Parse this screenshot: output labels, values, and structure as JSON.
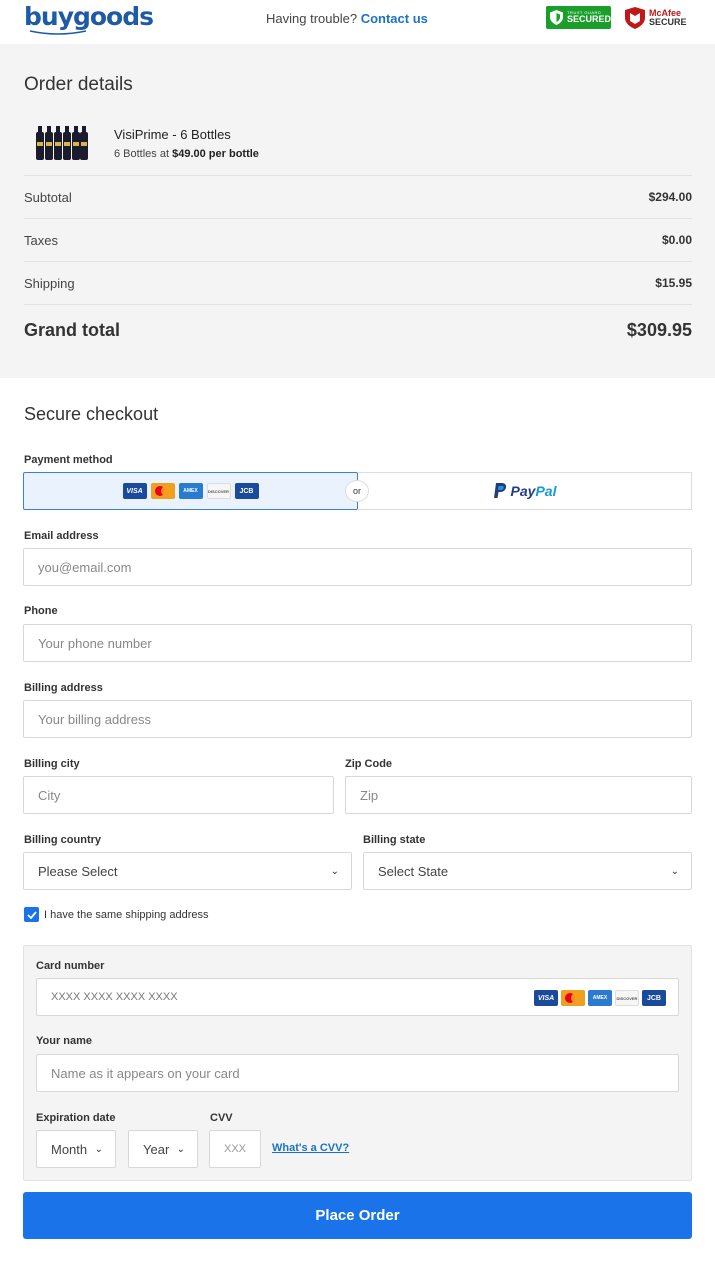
{
  "header": {
    "logo": "buygoods",
    "trouble_text": "Having trouble?",
    "contact_link": "Contact us",
    "trust_badge": "SECURED",
    "trust_badge_small": "TRUST GUARD",
    "mcafee_top": "McAfee",
    "mcafee_bottom": "SECURE"
  },
  "order": {
    "title": "Order details",
    "product_name": "VisiPrime - 6 Bottles",
    "product_desc_prefix": "6 Bottles at",
    "product_desc_price": "$49.00 per bottle",
    "rows": [
      {
        "label": "Subtotal",
        "value": "$294.00"
      },
      {
        "label": "Taxes",
        "value": "$0.00"
      },
      {
        "label": "Shipping",
        "value": "$15.95"
      }
    ],
    "grand_total_label": "Grand total",
    "grand_total_value": "$309.95"
  },
  "checkout": {
    "title": "Secure checkout",
    "payment_method_label": "Payment method",
    "or_text": "or",
    "paypal_pay": "Pay",
    "paypal_pal": "Pal",
    "card_brands": [
      "VISA",
      "MC",
      "AMEX",
      "DISCOVER",
      "JCB"
    ],
    "email_label": "Email address",
    "email_placeholder": "you@email.com",
    "phone_label": "Phone",
    "phone_placeholder": "Your phone number",
    "billing_address_label": "Billing address",
    "billing_address_placeholder": "Your billing address",
    "billing_city_label": "Billing city",
    "city_placeholder": "City",
    "zip_label": "Zip Code",
    "zip_placeholder": "Zip",
    "country_label": "Billing country",
    "country_value": "Please Select",
    "state_label": "Billing state",
    "state_value": "Select State",
    "same_shipping_label": "I have the same shipping address",
    "card_number_label": "Card number",
    "card_number_placeholder": "XXXX XXXX XXXX XXXX",
    "name_label": "Your name",
    "name_placeholder": "Name as it appears on your card",
    "expiration_label": "Expiration date",
    "month_value": "Month",
    "year_value": "Year",
    "cvv_label": "CVV",
    "cvv_placeholder": "XXX",
    "cvv_help": "What's a CVV?",
    "place_order": "Place Order"
  },
  "colors": {
    "brand_blue": "#1a73e8",
    "logo_blue": "#1f5aa6",
    "link_blue": "#1a73c7",
    "trust_green": "#1aa02a"
  }
}
